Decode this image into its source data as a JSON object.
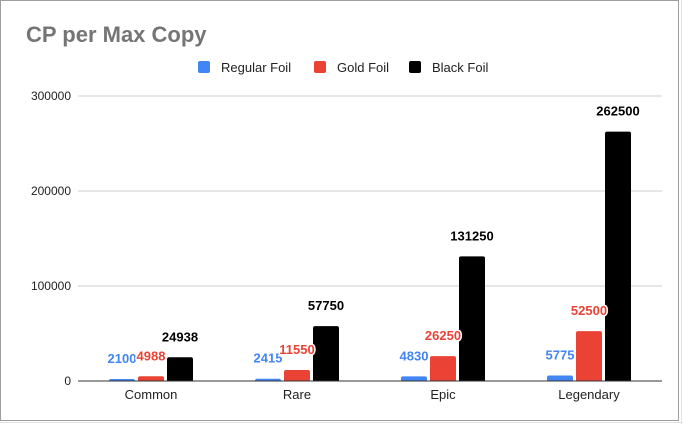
{
  "chart_data": {
    "type": "bar",
    "title": "CP per Max Copy",
    "categories": [
      "Common",
      "Rare",
      "Epic",
      "Legendary"
    ],
    "series": [
      {
        "name": "Regular Foil",
        "color": "#4285f4",
        "values": [
          2100,
          2415,
          4830,
          5775
        ]
      },
      {
        "name": "Gold Foil",
        "color": "#ea4335",
        "values": [
          4988,
          11550,
          26250,
          52500
        ]
      },
      {
        "name": "Black Foil",
        "color": "#000000",
        "values": [
          24938,
          57750,
          131250,
          262500
        ]
      }
    ],
    "ylim": [
      0,
      300000
    ],
    "yticks": [
      0,
      100000,
      200000,
      300000
    ],
    "xlabel": "",
    "ylabel": "",
    "grid": true,
    "legend_position": "top",
    "data_labels": true
  }
}
